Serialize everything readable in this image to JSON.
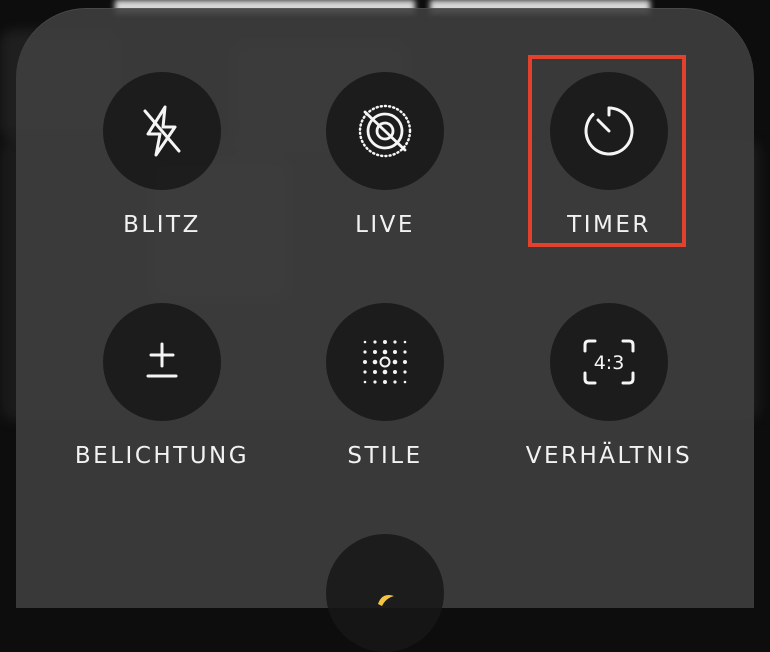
{
  "controls": [
    {
      "id": "flash",
      "label": "BLITZ",
      "icon": "flash-off-icon"
    },
    {
      "id": "live",
      "label": "LIVE",
      "icon": "live-photo-off-icon"
    },
    {
      "id": "timer",
      "label": "TIMER",
      "icon": "timer-icon",
      "highlighted": true
    },
    {
      "id": "exposure",
      "label": "BELICHTUNG",
      "icon": "exposure-icon"
    },
    {
      "id": "styles",
      "label": "STILE",
      "icon": "styles-grid-icon"
    },
    {
      "id": "ratio",
      "label": "VERHÄLTNIS",
      "icon": "aspect-ratio-icon",
      "value": "4:3"
    },
    {
      "id": "night",
      "label": "",
      "icon": "night-mode-icon"
    }
  ],
  "highlight_color": "#e2412e"
}
